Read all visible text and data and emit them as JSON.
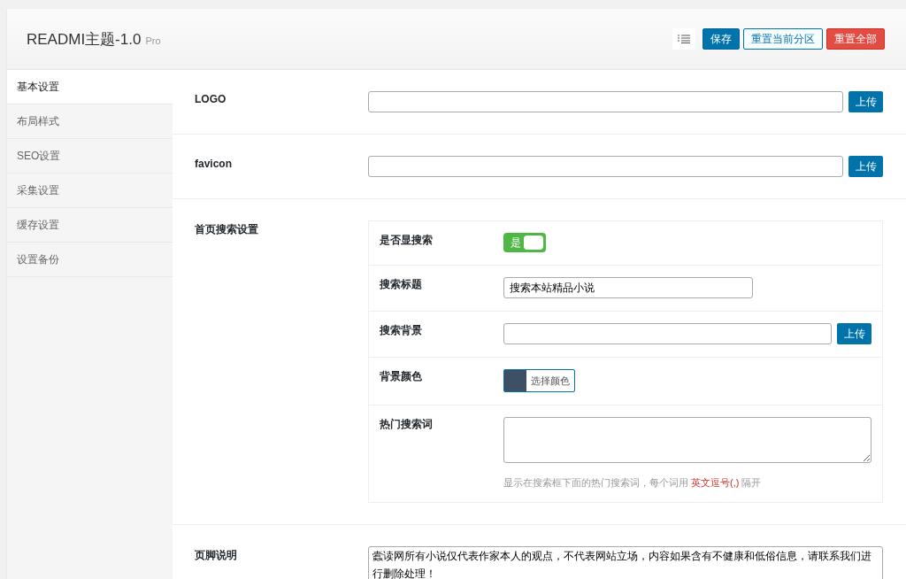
{
  "header": {
    "title": "READMI主题-1.0",
    "version": "Pro",
    "buttons": [
      {
        "label": "保存",
        "kind": "primary"
      },
      {
        "label": "重置当前分区",
        "kind": "outline"
      },
      {
        "label": "重置全部",
        "kind": "danger"
      }
    ]
  },
  "sidebar": {
    "items": [
      {
        "label": "基本设置",
        "selected": true
      },
      {
        "label": "布局样式",
        "selected": false
      },
      {
        "label": "SEO设置",
        "selected": false
      },
      {
        "label": "采集设置",
        "selected": false
      },
      {
        "label": "缓存设置",
        "selected": false
      },
      {
        "label": "设置备份",
        "selected": false
      }
    ]
  },
  "sections": [
    {
      "kind": "upload",
      "label": "LOGO",
      "button": "上传"
    },
    {
      "kind": "upload",
      "label": "favicon",
      "button": "上传"
    },
    {
      "kind": "group",
      "label": "首页搜索设置",
      "fields": [
        {
          "kind": "switch",
          "label": "是否显搜索",
          "on": true,
          "text": "是"
        },
        {
          "kind": "text",
          "label": "搜索标题",
          "value": "搜索本站精品小说"
        },
        {
          "kind": "upload",
          "label": "搜索背景",
          "button": "上传"
        },
        {
          "kind": "color",
          "label": "背景颜色",
          "color": "#3d5066",
          "button": "选择颜色"
        },
        {
          "kind": "textarea",
          "label": "热门搜索词",
          "hint": {
            "before": "显示在搜索框下面的热门搜索词，每个词用",
            "highlight": "英文逗号(,)",
            "after": "隔开"
          }
        }
      ]
    },
    {
      "kind": "textarea",
      "label": "页脚说明",
      "value": "蠹读网所有小说仅代表作家本人的观点，不代表网站立场，内容如果含有不健康和低俗信息，请联系我们进行删除处理！"
    }
  ]
}
